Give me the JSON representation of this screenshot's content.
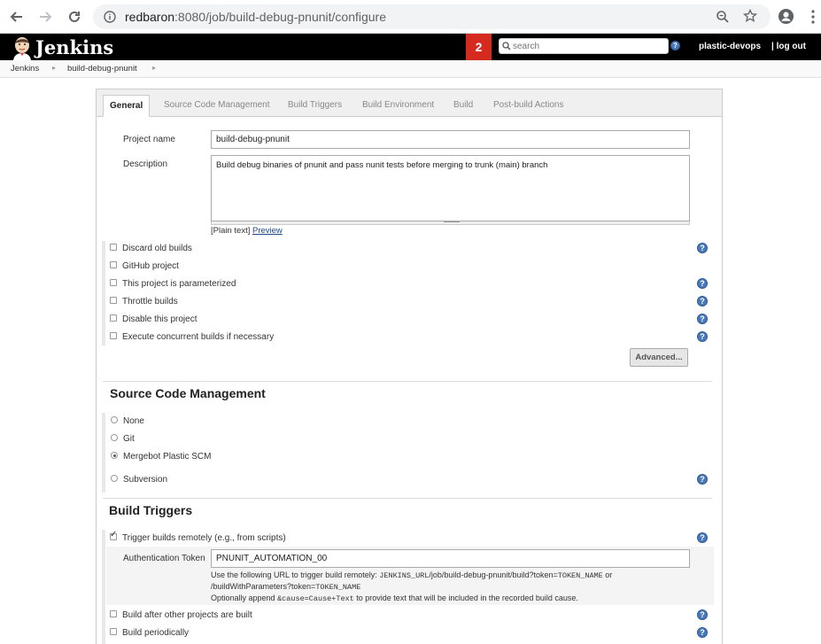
{
  "browser": {
    "url_host": "redbaron",
    "url_rest": ":8080/job/build-debug-pnunit/configure"
  },
  "header": {
    "logo": "Jenkins",
    "notification_count": "2",
    "search_placeholder": "search",
    "user": "plastic-devops",
    "logout": "| log out"
  },
  "breadcrumb": [
    "Jenkins",
    "build-debug-pnunit"
  ],
  "tabs": [
    "General",
    "Source Code Management",
    "Build Triggers",
    "Build Environment",
    "Build",
    "Post-build Actions"
  ],
  "general": {
    "project_name_label": "Project name",
    "project_name_value": "build-debug-pnunit",
    "description_label": "Description",
    "description_value": "Build debug binaries of pnunit and pass nunit tests before merging to trunk (main) branch",
    "plain_text": "[Plain text]",
    "preview": "Preview",
    "options": [
      {
        "label": "Discard old builds",
        "checked": false,
        "help": true
      },
      {
        "label": "GitHub project",
        "checked": false,
        "help": false
      },
      {
        "label": "This project is parameterized",
        "checked": false,
        "help": true
      },
      {
        "label": "Throttle builds",
        "checked": false,
        "help": true
      },
      {
        "label": "Disable this project",
        "checked": false,
        "help": true
      },
      {
        "label": "Execute concurrent builds if necessary",
        "checked": false,
        "help": true
      }
    ],
    "advanced_button": "Advanced..."
  },
  "scm": {
    "title": "Source Code Management",
    "options": [
      {
        "label": "None",
        "checked": false
      },
      {
        "label": "Git",
        "checked": false
      },
      {
        "label": "Mergebot Plastic SCM",
        "checked": true
      },
      {
        "label": "Subversion",
        "checked": false
      }
    ]
  },
  "triggers": {
    "title": "Build Triggers",
    "remote_label": "Trigger builds remotely (e.g., from scripts)",
    "token_label": "Authentication Token",
    "token_value": "PNUNIT_AUTOMATION_00",
    "note1_a": "Use the following URL to trigger build remotely: ",
    "note1_code": "JENKINS_URL",
    "note1_b": "/job/build-debug-pnunit/build?token=",
    "note1_code2": "TOKEN_NAME",
    "note1_c": " or",
    "note2_a": "/buildWithParameters?token=",
    "note2_code": "TOKEN_NAME",
    "note3_a": "Optionally append ",
    "note3_code": "&cause=Cause+Text",
    "note3_b": " to provide text that will be included in the recorded build cause.",
    "after_other": "Build after other projects are built",
    "periodically": "Build periodically"
  }
}
